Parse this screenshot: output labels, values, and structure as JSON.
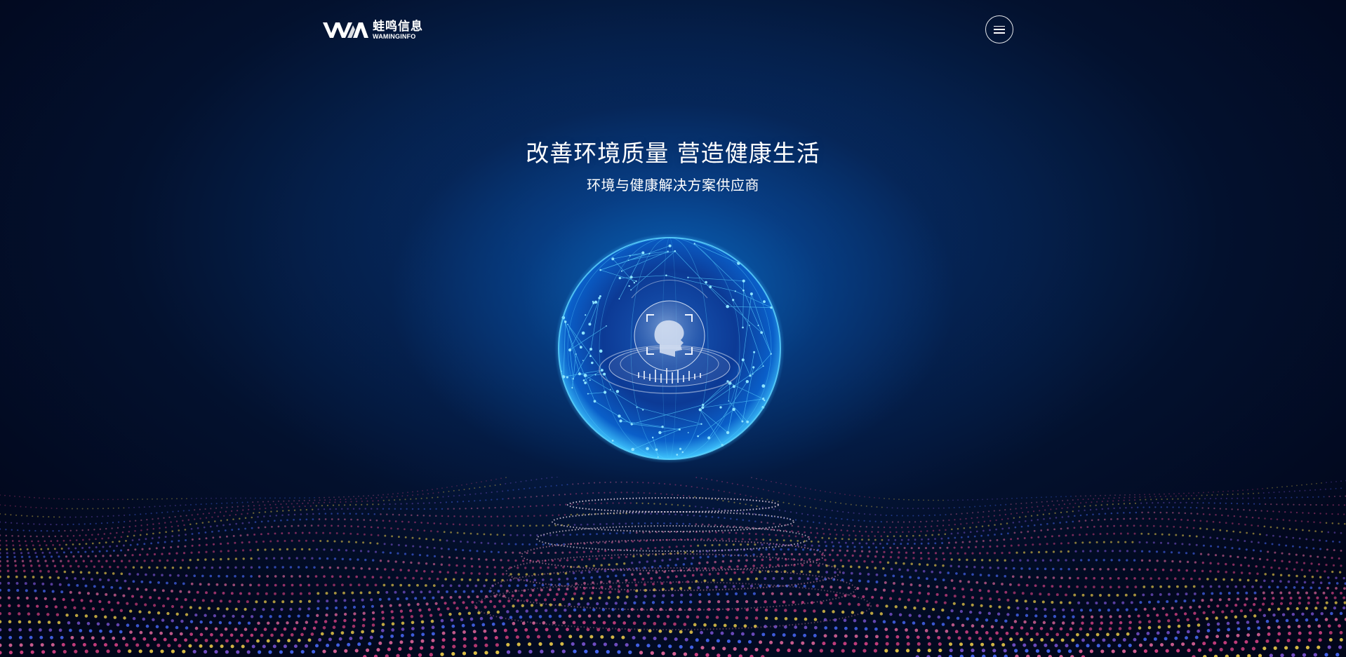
{
  "header": {
    "logo_cn": "蛙鸣信息",
    "logo_en": "WAMINGINFO",
    "logo_icon": "vwa-logo-icon",
    "menu_icon": "hamburger-menu-icon"
  },
  "hero": {
    "title": "改善环境质量 营造健康生活",
    "subtitle": "环境与健康解决方案供应商"
  },
  "colors": {
    "background": "#02061a",
    "glow": "#0a6ec8",
    "globe_line": "#3fc6ff",
    "wave_pink": "#e0458a",
    "wave_yellow": "#f2d24a",
    "wave_blue": "#4a6cff"
  }
}
